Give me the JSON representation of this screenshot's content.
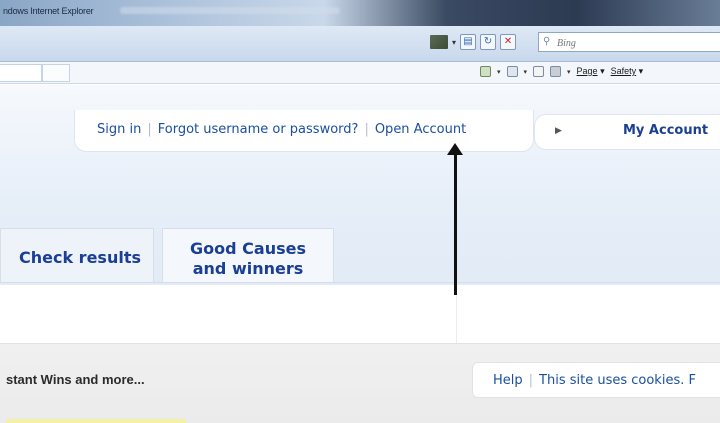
{
  "browser": {
    "title": "ndows Internet Explorer",
    "search_placeholder": "Bing",
    "toolbar": {
      "page_label": "Page",
      "safety_label": "Safety"
    }
  },
  "header": {
    "links": {
      "sign_in": "Sign in",
      "forgot": "Forgot username or password?",
      "open_account": "Open Account"
    },
    "my_account": "My Account"
  },
  "nav": {
    "tabs": [
      {
        "label": "Check results"
      },
      {
        "label_line1": "Good Causes",
        "label_line2": "and winners"
      }
    ]
  },
  "footer": {
    "left_text": "stant Wins and more...",
    "help": "Help",
    "cookies": "This site uses cookies. F"
  }
}
